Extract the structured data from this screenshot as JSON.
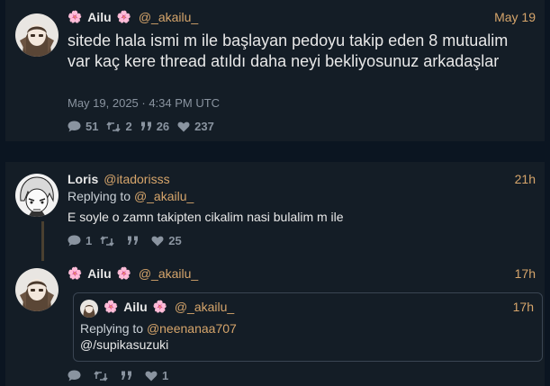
{
  "main_tweet": {
    "display_name": "Ailu",
    "flower": "🌸",
    "handle": "@_akailu_",
    "date": "May 19",
    "text": "sitede hala ismi m ile başlayan pedoyu takip eden 8 mutualim var kaç kere thread atıldı daha neyi bekliyosunuz arkadaşlar",
    "timestamp": "May 19, 2025 · 4:34 PM UTC",
    "stats": {
      "replies": "51",
      "retweets": "2",
      "quotes": "26",
      "likes": "237"
    }
  },
  "reply_tweet": {
    "display_name": "Loris",
    "handle": "@itadorisss",
    "date": "21h",
    "replying_to_label": "Replying to",
    "replying_to": "@_akailu_",
    "text": "E soyle o zamn takipten cikalim nasi bulalim m ile",
    "stats": {
      "replies": "1",
      "likes": "25"
    }
  },
  "third_tweet": {
    "display_name": "Ailu",
    "flower": "🌸",
    "handle": "@_akailu_",
    "date": "17h",
    "stats": {
      "likes": "1"
    },
    "quoted": {
      "display_name": "Ailu",
      "flower": "🌸",
      "handle": "@_akailu_",
      "date": "17h",
      "replying_to_label": "Replying to",
      "replying_to": "@neenanaa707",
      "text": "@/supikasuzuki"
    }
  },
  "colors": {
    "background": "#0b1521",
    "card": "#141d26",
    "accent": "#d6a56b",
    "muted": "#8a94a0"
  },
  "icons": [
    "comment-icon",
    "retweet-icon",
    "quote-icon",
    "heart-icon"
  ]
}
